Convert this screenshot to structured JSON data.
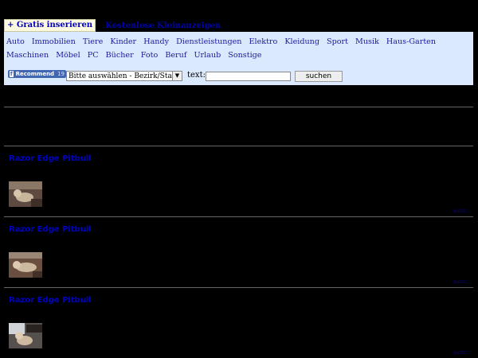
{
  "header": {
    "gratis_label": "+ Gratis inserieren",
    "kostenlos_label": "Kostenlose Kleinanzeigen"
  },
  "categories": [
    "Auto",
    "Immobilien",
    "Tiere",
    "Kinder",
    "Handy",
    "Dienstleistungen",
    "Elektro",
    "Kleidung",
    "Sport",
    "Musik",
    "Haus-Garten",
    "Maschinen",
    "Möbel",
    "PC",
    "Bücher",
    "Foto",
    "Beruf",
    "Urlaub",
    "Sonstige"
  ],
  "search": {
    "recommend_label": "Recommend",
    "recommend_count": "19",
    "district_select": "Bitte auswählen - Bezirk/Stadt",
    "text_label": "text:",
    "text_value": "",
    "button_label": "suchen"
  },
  "listings": [
    {
      "title": "Razor Edge Pitbull",
      "more": "mehr..."
    },
    {
      "title": "Razor Edge Pitbull",
      "more": "mehr..."
    },
    {
      "title": "Razor Edge Pitbull",
      "more": "mehr..."
    }
  ],
  "colors": {
    "background": "#000000",
    "panel": "#dbe9ff",
    "link": "#0000c0"
  }
}
